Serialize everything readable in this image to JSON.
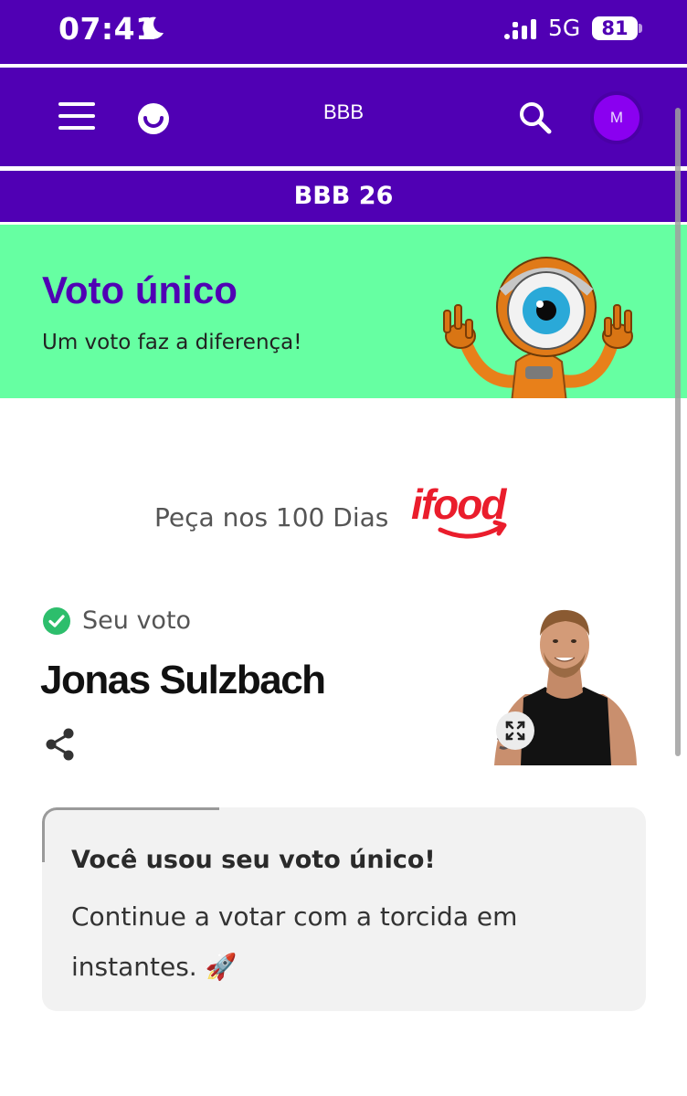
{
  "status_bar": {
    "time": "07:41",
    "network": "5G",
    "battery": "81",
    "icons": [
      "moon-icon",
      "signal-icon",
      "battery-icon"
    ]
  },
  "header": {
    "title": "BBB",
    "avatar_initial": "M",
    "icons": [
      "menu-icon",
      "globo-logo-icon",
      "search-icon"
    ]
  },
  "subbar": {
    "title": "BBB 26"
  },
  "banner": {
    "title": "Voto único",
    "subtitle": "Um voto faz a diferença!",
    "image": "big-brother-eye-mascot"
  },
  "sponsor": {
    "text": "Peça nos 100 Dias",
    "logo_text": "ifood"
  },
  "vote": {
    "label": "Seu voto",
    "candidate": "Jonas Sulzbach",
    "icons": [
      "check-circle-icon",
      "share-icon",
      "expand-icon"
    ]
  },
  "info_card": {
    "title": "Você usou seu voto único!",
    "body": "Continue a votar com a torcida em instantes. 🚀"
  },
  "colors": {
    "brand_purple": "#5000b4",
    "banner_green": "#66ffa2",
    "check_green": "#2dbe6c",
    "ifood_red": "#ea1d2c"
  }
}
